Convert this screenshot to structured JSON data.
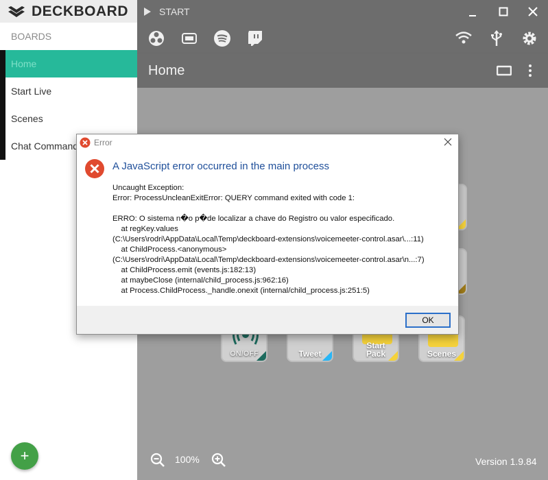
{
  "app": {
    "brand": "DECKBOARD",
    "start_label": "START",
    "version": "Version 1.9.84"
  },
  "colors": {
    "accent": "#26b99a",
    "fab": "#43a047",
    "error": "#e04a2f",
    "heading": "#1f4f9a"
  },
  "toolbar": {
    "icons": [
      "obs-icon",
      "streamlabs-icon",
      "spotify-icon",
      "twitch-icon",
      "wifi-icon",
      "usb-icon",
      "settings-icon"
    ]
  },
  "sidebar": {
    "heading": "BOARDS",
    "items": [
      {
        "label": "Home",
        "active": true
      },
      {
        "label": "Start Live",
        "active": false
      },
      {
        "label": "Scenes",
        "active": false
      },
      {
        "label": "Chat Commands",
        "active": false
      }
    ],
    "add_button": "+"
  },
  "board": {
    "title": "Home",
    "zoom": "100%",
    "tiles": [
      {
        "label": "ON/OFF"
      },
      {
        "label": "Tweet"
      },
      {
        "label": "Start\nPack"
      },
      {
        "label": "Scenes"
      }
    ]
  },
  "dialog": {
    "title": "Error",
    "heading": "A JavaScript error occurred in the main process",
    "message": "Uncaught Exception:\nError: ProcessUncleanExitError: QUERY command exited with code 1:\n\nERRO: O sistema n�o p�de localizar a chave do Registro ou valor especificado.\n    at regKey.values\n(C:\\Users\\rodri\\AppData\\Local\\Temp\\deckboard-extensions\\voicemeeter-control.asar\\...:11)\n    at ChildProcess.<anonymous>\n(C:\\Users\\rodri\\AppData\\Local\\Temp\\deckboard-extensions\\voicemeeter-control.asar\\n...:7)\n    at ChildProcess.emit (events.js:182:13)\n    at maybeClose (internal/child_process.js:962:16)\n    at Process.ChildProcess._handle.onexit (internal/child_process.js:251:5)",
    "ok_label": "OK"
  }
}
